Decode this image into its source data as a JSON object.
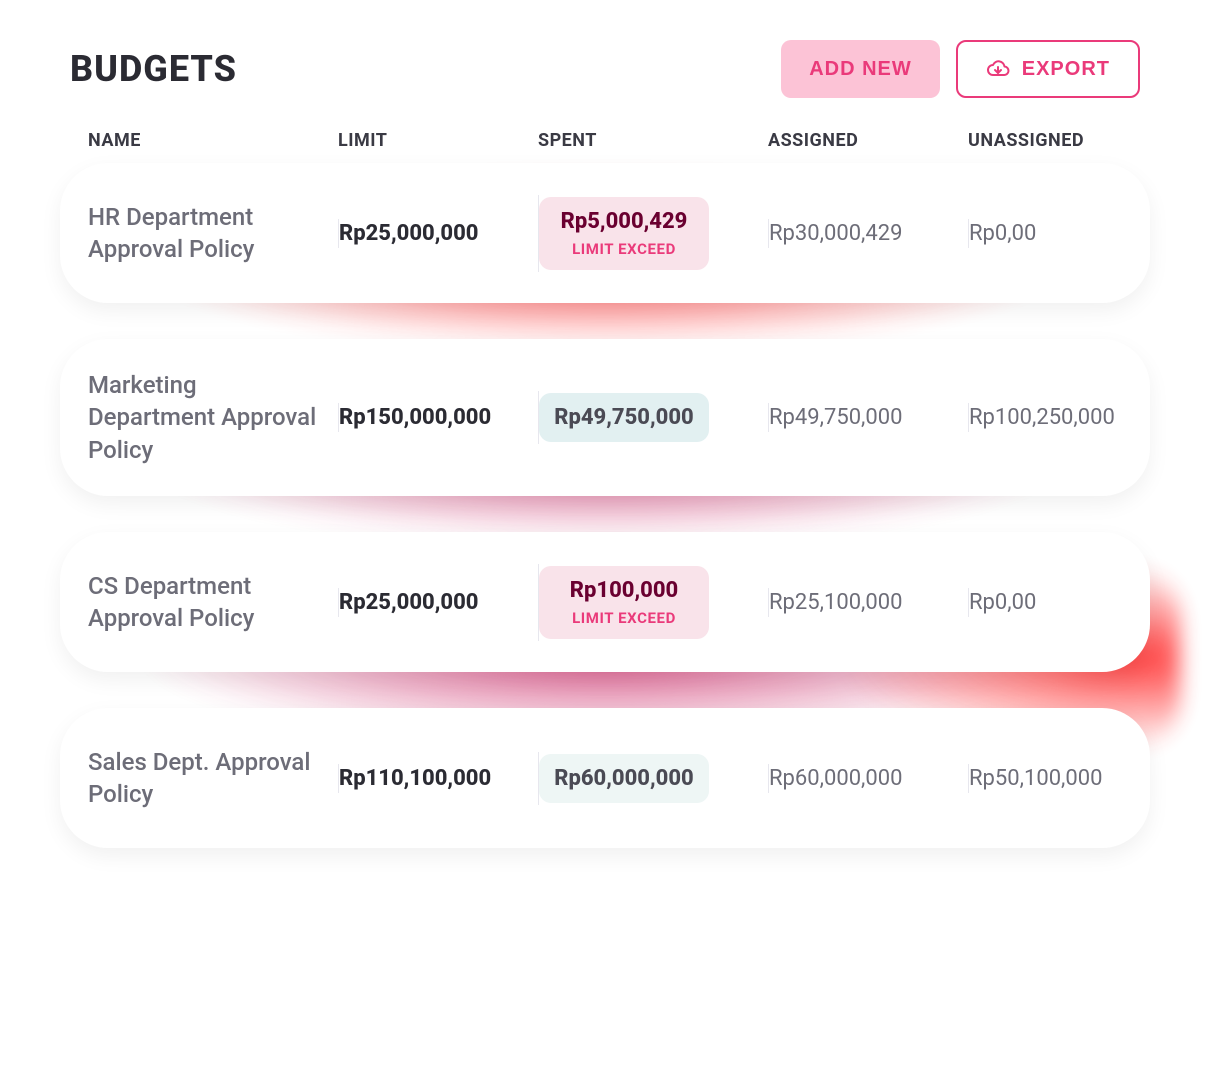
{
  "header": {
    "title": "BUDGETS",
    "add_label": "ADD NEW",
    "export_label": "EXPORT"
  },
  "columns": {
    "name": "NAME",
    "limit": "LIMIT",
    "spent": "SPENT",
    "assigned": "ASSIGNED",
    "unassigned": "UNASSIGNED"
  },
  "labels": {
    "limit_exceed": "LIMIT EXCEED"
  },
  "rows": [
    {
      "name": "HR Department Approval Policy",
      "limit": "Rp25,000,000",
      "spent": "Rp5,000,429",
      "spent_status": "exceed",
      "assigned": "Rp30,000,429",
      "unassigned": "Rp0,00"
    },
    {
      "name": "Marketing Department Approval Policy",
      "limit": "Rp150,000,000",
      "spent": "Rp49,750,000",
      "spent_status": "ok",
      "assigned": "Rp49,750,000",
      "unassigned": "Rp100,250,000"
    },
    {
      "name": "CS Department Approval Policy",
      "limit": "Rp25,000,000",
      "spent": "Rp100,000",
      "spent_status": "exceed",
      "assigned": "Rp25,100,000",
      "unassigned": "Rp0,00"
    },
    {
      "name": "Sales Dept. Approval Policy",
      "limit": "Rp110,100,000",
      "spent": "Rp60,000,000",
      "spent_status": "plain",
      "assigned": "Rp60,000,000",
      "unassigned": "Rp50,100,000"
    }
  ]
}
